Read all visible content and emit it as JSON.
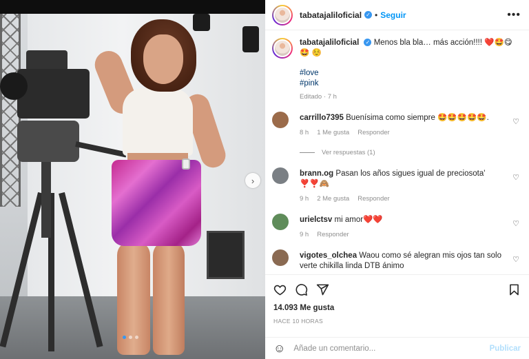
{
  "post": {
    "username": "tabatajaliloficial",
    "follow_separator": "•",
    "follow_label": "Seguir",
    "more_icon": "more-horizontal-icon"
  },
  "caption": {
    "username": "tabatajaliloficial",
    "text": "Menos bla bla… más acción!!!! ❤️🤩😋🤩 ☺️",
    "hashtags": [
      "#love",
      "#pink"
    ],
    "edited": "Editado",
    "time": "7 h"
  },
  "comments": [
    {
      "username": "carrillo7395",
      "text": "Buenísima como siempre 🤩🤩🤩🤩🤩.",
      "time": "8 h",
      "likes": "1 Me gusta",
      "reply": "Responder",
      "replies": "Ver respuestas (1)",
      "avatar_color": "#9b6b4a"
    },
    {
      "username": "brann.og",
      "text": "Pasan los años sigues igual de preciosota' ❣️❣️🙈",
      "time": "9 h",
      "likes": "2 Me gusta",
      "reply": "Responder",
      "avatar_color": "#7a7f84"
    },
    {
      "username": "urielctsv",
      "text": "mi amor❤️❤️",
      "time": "9 h",
      "likes": "",
      "reply": "Responder",
      "avatar_color": "#5f8c5a"
    },
    {
      "username": "vigotes_olchea",
      "text": "Waou como sé alegran mis ojos tan solo verte chikilla linda DTB ánimo",
      "time": "",
      "likes": "",
      "reply": "",
      "avatar_color": "#8a6a52"
    }
  ],
  "actions": {
    "like_count": "14.093 Me gusta",
    "posted_ago": "HACE 10 HORAS"
  },
  "add_comment": {
    "placeholder": "Añade un comentario...",
    "post_label": "Publicar"
  },
  "carousel": {
    "slides": 3,
    "active": 0
  },
  "colors": {
    "link": "#0095f6",
    "verified": "#3897f0",
    "muted": "#8e8e8e"
  }
}
